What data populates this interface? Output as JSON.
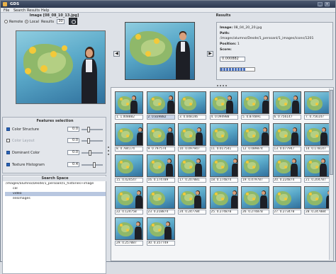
{
  "window": {
    "title": "GDS",
    "icon": "app-icon"
  },
  "menu": [
    "File",
    "Search",
    "Results",
    "Help"
  ],
  "query": {
    "image_title": "Image [08_08_10_13.jpg]",
    "modes": [
      "Remote",
      "Local"
    ],
    "selected_mode": "Local",
    "results_label": "Results",
    "results_count": "30",
    "camera_icon": "camera-icon"
  },
  "features": {
    "title": "Features selection",
    "items": [
      {
        "label": "Color Structure",
        "checked": true,
        "value": "0.0",
        "dim": false
      },
      {
        "label": "Color Layout",
        "checked": false,
        "value": "0.0",
        "dim": true
      },
      {
        "label": "Dominant Color",
        "checked": true,
        "value": "0.0",
        "dim": false
      },
      {
        "label": "Texture Histogram",
        "checked": true,
        "value": "0.4",
        "dim": false
      }
    ]
  },
  "search_space": {
    "title": "Search Space",
    "nodes": [
      {
        "label": "/images/alumno/Desde/1_persoanl/1_histories+image",
        "indent": 0,
        "selected": false
      },
      {
        "label": "cal",
        "indent": 1,
        "selected": false
      },
      {
        "label": "video",
        "indent": 1,
        "selected": true
      },
      {
        "label": "eesimages",
        "indent": 1,
        "selected": false
      }
    ]
  },
  "results": {
    "title": "Results",
    "prev_icon": "arrow-left-icon",
    "next_icon": "arrow-right-icon",
    "info": {
      "image_label": "Image:",
      "image_value": "08_04_20_20.jpg",
      "path_label": "Path:",
      "path_value": "/images/alumno/Desde/1_persoanl/1_images/icons/1201",
      "position_label": "Position:",
      "position_value": "1",
      "score_label": "Score:",
      "score_value": "0.000882",
      "progress": 0.72
    },
    "grid": [
      "1. 1.008882",
      "2. 0.839882",
      "3. 0.048146",
      "4. 0.094988",
      "5. 0.874891",
      "6. 0.756147",
      "7. 0.756147",
      "8. 0.784174",
      "9. 0.797574",
      "10. 0.097947",
      "11. 0.017541",
      "12. 0.089874",
      "13. 0.077947",
      "14. 0.178147",
      "15. 0.424547",
      "16. 0.174789",
      "17. 0.207881",
      "18. 0.174874",
      "19. 0.479787",
      "20. 0.224874",
      "21. 0.204787",
      "22. 0.124758",
      "23. 0.218874",
      "24. 0.247784",
      "25. 0.274878",
      "26. 0.274878",
      "27. 0.273478",
      "28. 0.247884",
      "29. 0.257887",
      "30. 0.357749"
    ],
    "selected_index": 1
  }
}
